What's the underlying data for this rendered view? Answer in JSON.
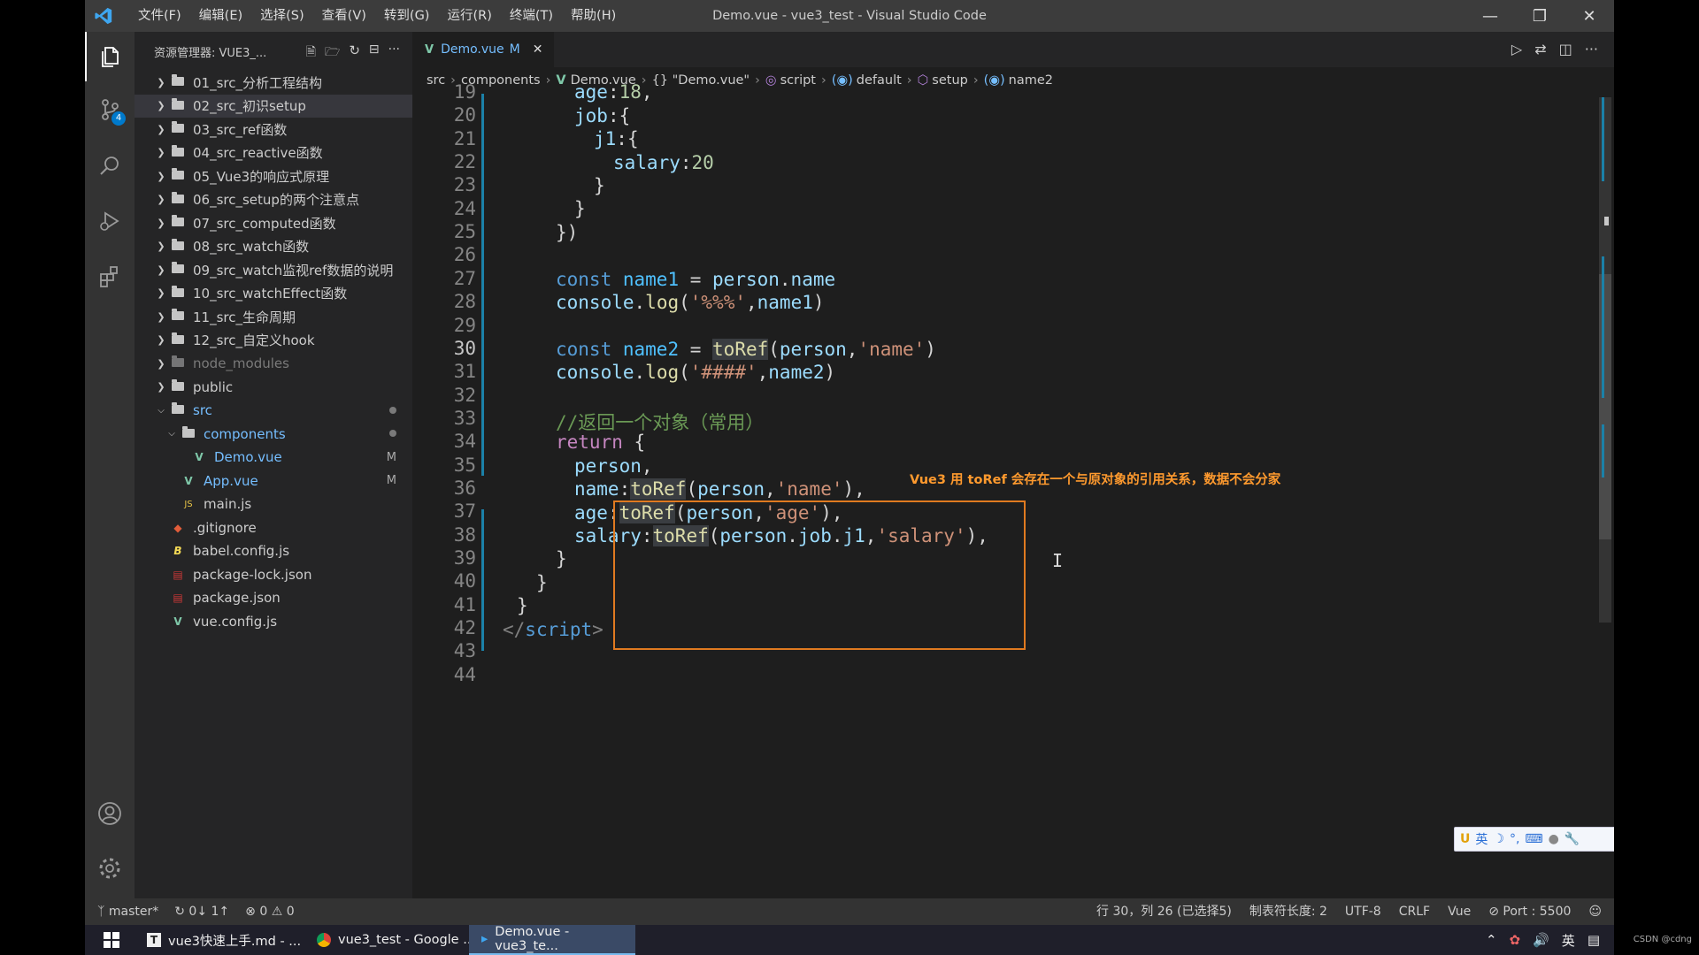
{
  "titlebar": {
    "menus": [
      "文件(F)",
      "编辑(E)",
      "选择(S)",
      "查看(V)",
      "转到(G)",
      "运行(R)",
      "终端(T)",
      "帮助(H)"
    ],
    "title": "Demo.vue - vue3_test - Visual Studio Code"
  },
  "activity": {
    "scm_badge": "4"
  },
  "sidebar": {
    "header": "资源管理器: VUE3_...",
    "items": [
      {
        "label": "01_src_分析工程结构",
        "type": "folder",
        "indent": 0
      },
      {
        "label": "02_src_初识setup",
        "type": "folder",
        "indent": 0
      },
      {
        "label": "03_src_ref函数",
        "type": "folder",
        "indent": 0
      },
      {
        "label": "04_src_reactive函数",
        "type": "folder",
        "indent": 0
      },
      {
        "label": "05_Vue3的响应式原理",
        "type": "folder",
        "indent": 0
      },
      {
        "label": "06_src_setup的两个注意点",
        "type": "folder",
        "indent": 0
      },
      {
        "label": "07_src_computed函数",
        "type": "folder",
        "indent": 0
      },
      {
        "label": "08_src_watch函数",
        "type": "folder",
        "indent": 0
      },
      {
        "label": "09_src_watch监视ref数据的说明",
        "type": "folder",
        "indent": 0
      },
      {
        "label": "10_src_watchEffect函数",
        "type": "folder",
        "indent": 0
      },
      {
        "label": "11_src_生命周期",
        "type": "folder",
        "indent": 0
      },
      {
        "label": "12_src_自定义hook",
        "type": "folder",
        "indent": 0
      },
      {
        "label": "node_modules",
        "type": "folder-dim",
        "indent": 0
      },
      {
        "label": "public",
        "type": "folder",
        "indent": 0
      },
      {
        "label": "src",
        "type": "folder-open",
        "indent": 0
      },
      {
        "label": "components",
        "type": "folder-open",
        "indent": 1
      },
      {
        "label": "Demo.vue",
        "type": "vue",
        "indent": 2,
        "status": "M"
      },
      {
        "label": "App.vue",
        "type": "vue",
        "indent": 1,
        "status": "M"
      },
      {
        "label": "main.js",
        "type": "js",
        "indent": 1
      },
      {
        "label": ".gitignore",
        "type": "git",
        "indent": 0
      },
      {
        "label": "babel.config.js",
        "type": "babel",
        "indent": 0
      },
      {
        "label": "package-lock.json",
        "type": "json",
        "indent": 0
      },
      {
        "label": "package.json",
        "type": "json",
        "indent": 0
      },
      {
        "label": "vue.config.js",
        "type": "vue",
        "indent": 0
      }
    ]
  },
  "tab": {
    "label": "Demo.vue",
    "status": "M"
  },
  "breadcrumb": [
    "src",
    "components",
    "Demo.vue",
    "{} \"Demo.vue\"",
    "script",
    "default",
    "setup",
    "name2"
  ],
  "code": {
    "line_numbers": [
      "19",
      "20",
      "21",
      "22",
      "23",
      "24",
      "25",
      "26",
      "27",
      "28",
      "29",
      "30",
      "31",
      "32",
      "33",
      "34",
      "35",
      "36",
      "37",
      "38",
      "39",
      "40",
      "41",
      "42",
      "43",
      "44"
    ],
    "current_line": "30",
    "annotation": "Vue3 用 toRef 会存在一个与原对象的引用关系，数据不会分家"
  },
  "statusbar": {
    "branch": "master*",
    "sync": "0↓ 1↑",
    "errors": "0",
    "warnings": "0",
    "position": "行 30，列 26 (已选择5)",
    "tabsize": "制表符长度: 2",
    "encoding": "UTF-8",
    "eol": "CRLF",
    "language": "Vue",
    "port": "Port : 5500"
  },
  "ime": {
    "lang": "英"
  },
  "taskbar": {
    "items": [
      "vue3快速上手.md - ...",
      "vue3_test - Google ...",
      "Demo.vue - vue3_te..."
    ],
    "tray_lang": "英"
  },
  "watermark": "CSDN @cdng"
}
